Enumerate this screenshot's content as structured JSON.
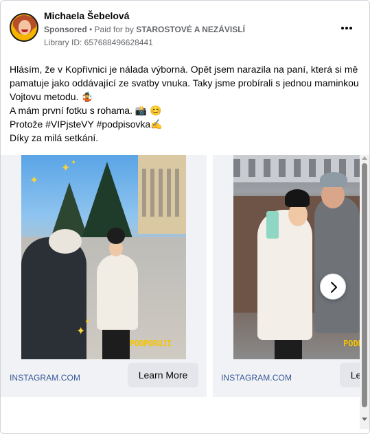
{
  "header": {
    "author": "Michaela Šebelová",
    "sponsored": "Sponsored",
    "separator": " • ",
    "paid_prefix": "Paid for by ",
    "payer": "STAROSTOVÉ A NEZÁVISLÍ",
    "library_id": "Library ID: 657688496628441",
    "more_icon": "more-horizontal-icon"
  },
  "post": {
    "lines": [
      "Hlásím, že v Kopřivnici je nálada výborná. Opět jsem narazila na paní, která si mě",
      "pamatuje jako oddávající ze svatby vnuka. Taky jsme probírali s jednou maminkou",
      "Vojtovu metodu. 🤹",
      "A mám první fotku s rohama. 📸 😊",
      "Protože #VIPjsteVY #podpisovka✍️",
      "Díky za milá setkání."
    ]
  },
  "carousel": {
    "cards": [
      {
        "source": "INSTAGRAM.COM",
        "cta": "Learn More",
        "logo_text": "PODPORUJI"
      },
      {
        "source": "INSTAGRAM.COM",
        "cta": "Learn More",
        "logo_text": "PODPO"
      }
    ],
    "next_icon": "chevron-right-icon"
  },
  "colors": {
    "link": "#385898",
    "secondary_text": "#65676b",
    "button_bg": "#e4e6eb",
    "accent_yellow": "#f5c400"
  }
}
